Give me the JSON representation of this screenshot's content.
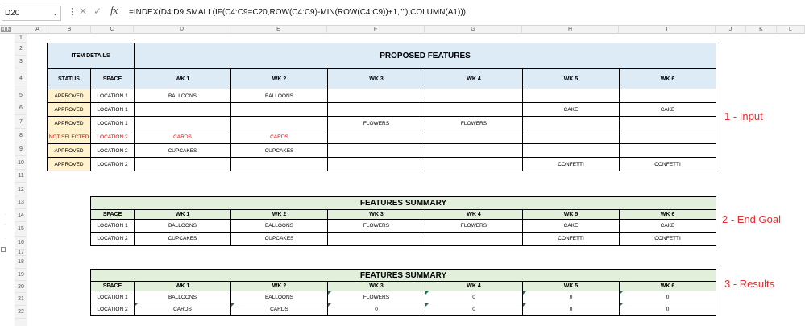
{
  "formula_bar": {
    "name_box": "D20",
    "name_box_arrow": "⌄",
    "dots_icon": "⋮",
    "cancel_icon": "✕",
    "enter_icon": "✓",
    "fx_label": "fx",
    "formula": "=INDEX(D4:D9,SMALL(IF(C4:C9=C20,ROW(C4:C9)-MIN(ROW(C4:C9))+1,\"\"),COLUMN(A1)))"
  },
  "outline": {
    "levels": [
      "1",
      "2"
    ]
  },
  "columns": [
    "A",
    "B",
    "C",
    "D",
    "E",
    "F",
    "G",
    "H",
    "I",
    "J",
    "K",
    "L"
  ],
  "rows": [
    "1",
    "2",
    "3",
    "4",
    "5",
    "6",
    "7",
    "8",
    "9",
    "10",
    "11",
    "12",
    "13",
    "14",
    "15",
    "16",
    "17",
    "18",
    "19",
    "20",
    "21",
    "22"
  ],
  "input": {
    "item_details": "ITEM DETAILS",
    "proposed_features": "PROPOSED FEATURES",
    "status_header": "STATUS",
    "space_header": "SPACE",
    "weeks": [
      "WK 1",
      "WK 2",
      "WK 3",
      "WK 4",
      "WK 5",
      "WK 6"
    ],
    "rows": [
      {
        "status": "APPROVED",
        "space": "LOCATION 1",
        "cells": [
          "BALLOONS",
          "BALLOONS",
          "",
          "",
          "",
          ""
        ],
        "red": false
      },
      {
        "status": "APPROVED",
        "space": "LOCATION 1",
        "cells": [
          "",
          "",
          "",
          "",
          "CAKE",
          "CAKE"
        ],
        "red": false
      },
      {
        "status": "APPROVED",
        "space": "LOCATION 1",
        "cells": [
          "",
          "",
          "FLOWERS",
          "FLOWERS",
          "",
          ""
        ],
        "red": false
      },
      {
        "status": "NOT SELECTED",
        "space": "LOCATION 2",
        "cells": [
          "CARDS",
          "CARDS",
          "",
          "",
          "",
          ""
        ],
        "red": true
      },
      {
        "status": "APPROVED",
        "space": "LOCATION 2",
        "cells": [
          "CUPCAKES",
          "CUPCAKES",
          "",
          "",
          "",
          ""
        ],
        "red": false
      },
      {
        "status": "APPROVED",
        "space": "LOCATION 2",
        "cells": [
          "",
          "",
          "",
          "",
          "CONFETTI",
          "CONFETTI"
        ],
        "red": false
      }
    ]
  },
  "goal": {
    "title": "FEATURES SUMMARY",
    "space_header": "SPACE",
    "weeks": [
      "WK 1",
      "WK 2",
      "WK 3",
      "WK 4",
      "WK 5",
      "WK 6"
    ],
    "rows": [
      {
        "space": "LOCATION 1",
        "cells": [
          "BALLOONS",
          "BALLOONS",
          "FLOWERS",
          "FLOWERS",
          "CAKE",
          "CAKE"
        ]
      },
      {
        "space": "LOCATION 2",
        "cells": [
          "CUPCAKES",
          "CUPCAKES",
          "",
          "",
          "CONFETTI",
          "CONFETTI"
        ]
      }
    ]
  },
  "results": {
    "title": "FEATURES SUMMARY",
    "space_header": "SPACE",
    "weeks": [
      "WK 1",
      "WK 2",
      "WK 3",
      "WK 4",
      "WK 5",
      "WK 6"
    ],
    "rows": [
      {
        "space": "LOCATION 1",
        "cells": [
          "BALLOONS",
          "BALLOONS",
          "FLOWERS",
          "0",
          "0",
          "0"
        ]
      },
      {
        "space": "LOCATION 2",
        "cells": [
          "CARDS",
          "CARDS",
          "0",
          "0",
          "0",
          "0"
        ]
      }
    ]
  },
  "labels": {
    "input": "1 - Input",
    "goal": "2 - End Goal",
    "results": "3 - Results"
  },
  "colors": {
    "label_red": "#e03030",
    "header_blue": "#ddebf7",
    "header_green": "#e2efda",
    "status_tan": "#fff2cc",
    "error_red": "#e00000",
    "green_indicator": "#1e7145"
  }
}
